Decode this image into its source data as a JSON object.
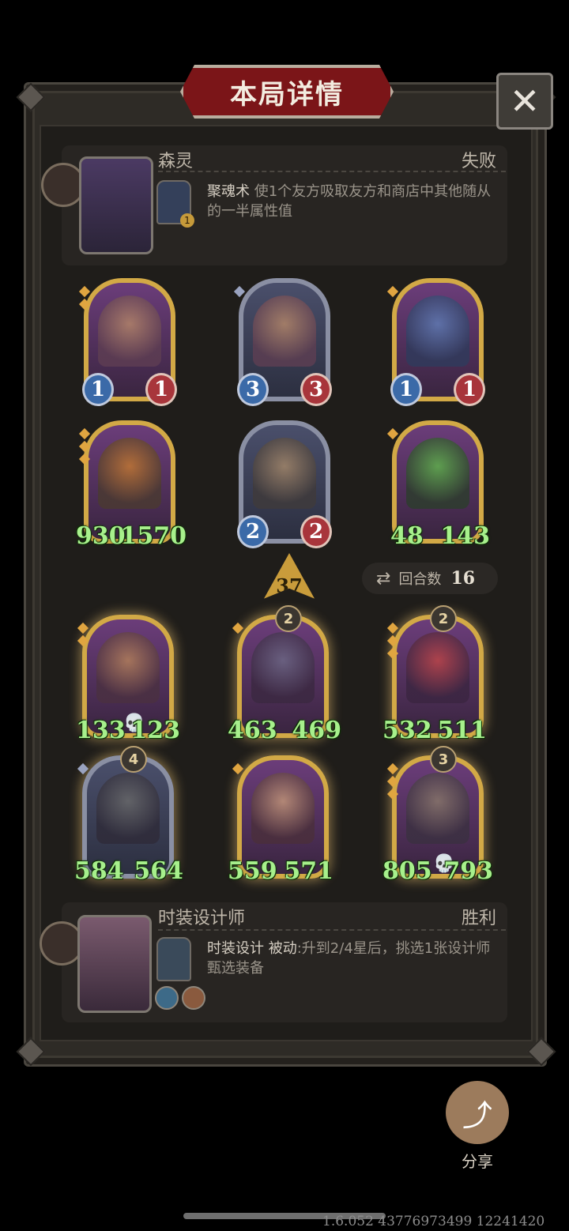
{
  "title": "本局详情",
  "close_glyph": "✕",
  "opponent": {
    "name": "森灵",
    "result": "失败",
    "skill_name": "聚魂术",
    "skill_desc": "使1个友方吸取友方和商店中其他随从的一半属性值",
    "skill_badge": "1"
  },
  "opponent_units": [
    {
      "atk": "1",
      "hp": "1"
    },
    {
      "atk": "3",
      "hp": "3"
    },
    {
      "atk": "1",
      "hp": "1"
    },
    {
      "atk": "930",
      "hp": "1570"
    },
    {
      "atk": "2",
      "hp": "2"
    },
    {
      "atk": "48",
      "hp": "143"
    }
  ],
  "level": "37",
  "turns": {
    "label": "回合数",
    "value": "16",
    "icon": "swap-icon"
  },
  "player_units": [
    {
      "star": "",
      "atk": "133",
      "hp": "123",
      "skull": true
    },
    {
      "star": "2",
      "atk": "463",
      "hp": "469"
    },
    {
      "star": "2",
      "atk": "532",
      "hp": "511"
    },
    {
      "star": "4",
      "atk": "584",
      "hp": "564"
    },
    {
      "star": "",
      "atk": "559",
      "hp": "571"
    },
    {
      "star": "3",
      "atk": "805",
      "hp": "793",
      "skull": true
    }
  ],
  "player": {
    "name": "时装设计师",
    "result": "胜利",
    "skill_name": "时装设计",
    "skill_type": "被动",
    "skill_desc": ":升到2/4星后，挑选1张设计师甄选装备"
  },
  "share_label": "分享",
  "version": "1.6.052 43776973499 12241420",
  "colors": {
    "accent": "#7b1518",
    "stat_green": "#a7f08c",
    "gold": "#c99c3b"
  }
}
